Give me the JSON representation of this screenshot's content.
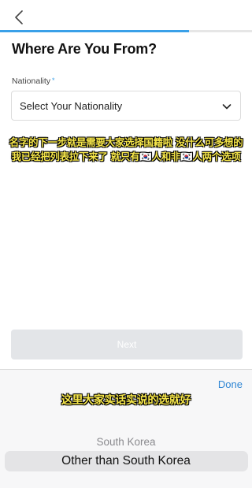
{
  "header": {
    "back_icon": "chevron-left-icon",
    "progress_percent": 75
  },
  "form": {
    "title": "Where Are You From?",
    "field_label": "Nationality",
    "required_marker": "*",
    "select_placeholder": "Select Your Nationality",
    "select_icon": "chevron-down-icon",
    "next_label": "Next"
  },
  "captions": {
    "line1": "名字的下一步就是需要大家选择国籍啦 没什么可多想的",
    "line2": "我已经把列表拉下来了 就只有🇰🇷人和非🇰🇷人两个选项",
    "line3": "这里大家实话实说的选就好"
  },
  "picker": {
    "done_label": "Done",
    "options": [
      "South Korea",
      "Other than South Korea"
    ],
    "selected": "Other than South Korea"
  },
  "colors": {
    "accent": "#3aa0e8",
    "done_link": "#2f86d4",
    "caption_text": "#f6e64a",
    "button_disabled": "#e3e5e8"
  }
}
